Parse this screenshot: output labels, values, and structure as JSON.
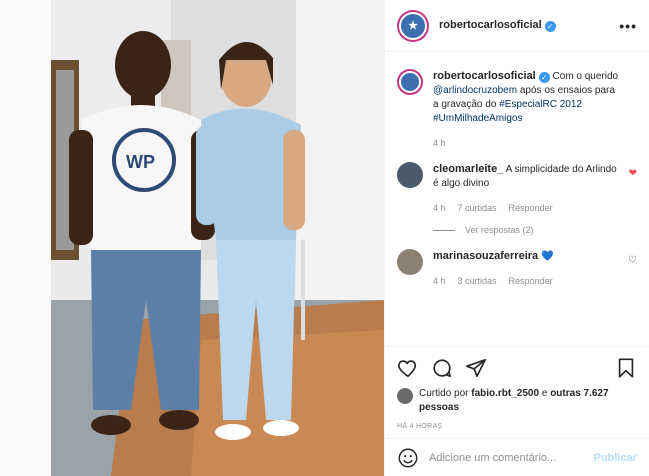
{
  "post": {
    "username": "robertocarlosoficial",
    "verified_mark": "✓",
    "avatar_text": "★",
    "more_icon_label": "•••",
    "caption": {
      "prefix": "Com o querido ",
      "mention": "@arlindocruzobem",
      "middle": " após os ensaios para a gravação do ",
      "tag1": "#EspecialRC 2012",
      "tag2": "#UmMilhadeAmigos",
      "time": "4 h"
    }
  },
  "comments": [
    {
      "username": "cleomarleite_",
      "text": "A simplicidade do Arlindo é algo divino",
      "time": "4 h",
      "likes": "7 curtidas",
      "reply": "Responder",
      "liked": true,
      "replies_label": "Ver respostas (2)"
    },
    {
      "username": "marinasouzaferreira",
      "text": "💙",
      "time": "4 h",
      "likes": "3 curtidas",
      "reply": "Responder",
      "liked": false
    }
  ],
  "likes": {
    "prefix": "Curtido por ",
    "user": "fabio.rbt_2500",
    "middle": " e ",
    "others": "outras 7.627 pessoas"
  },
  "timestamp": "HÁ 4 HORAS",
  "comment_box": {
    "placeholder": "Adicione um comentário...",
    "publish_label": "Publicar"
  },
  "colors": {
    "accent_link": "#00376b",
    "like_red": "#ed4956",
    "verified_blue": "#3897f0",
    "publish_disabled": "#b2dffc"
  },
  "icons": [
    "heart-icon",
    "comment-icon",
    "share-icon",
    "bookmark-icon",
    "emoji-icon"
  ]
}
